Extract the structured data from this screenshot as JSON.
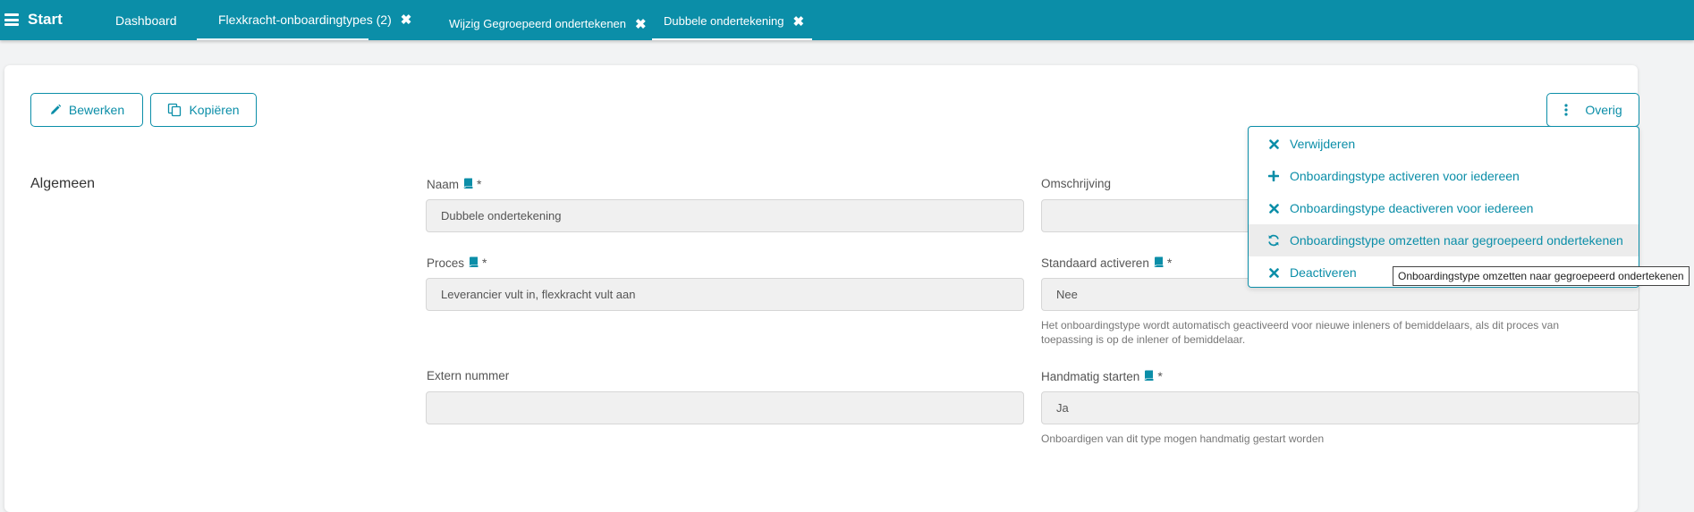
{
  "topbar": {
    "brand": "Start",
    "tabs": [
      {
        "label": "Dashboard",
        "closable": false
      },
      {
        "label": "Flexkracht-onboardingtypes (2)",
        "closable": true
      },
      {
        "label": "Wijzig Gegroepeerd ondertekenen",
        "closable": true
      },
      {
        "label": "Dubbele ondertekening",
        "closable": true
      }
    ],
    "close_glyph": "✖"
  },
  "toolbar": {
    "edit_label": "Bewerken",
    "copy_label": "Kopiëren",
    "more_label": "Overig"
  },
  "dropdown": {
    "items": [
      {
        "label": "Verwijderen",
        "icon": "times-icon"
      },
      {
        "label": "Onboardingstype activeren voor iedereen",
        "icon": "plus-icon"
      },
      {
        "label": "Onboardingstype deactiveren voor iedereen",
        "icon": "times-icon"
      },
      {
        "label": "Onboardingstype omzetten naar gegroepeerd ondertekenen",
        "icon": "refresh-icon"
      },
      {
        "label": "Deactiveren",
        "icon": "times-icon"
      }
    ]
  },
  "tooltip": "Onboardingstype omzetten naar gegroepeerd ondertekenen",
  "section": {
    "title": "Algemeen"
  },
  "fields": {
    "naam": {
      "label": "Naam",
      "value": "Dubbele ondertekening",
      "required": "*"
    },
    "omschrijving": {
      "label": "Omschrijving",
      "value": ""
    },
    "proces": {
      "label": "Proces",
      "value": "Leverancier vult in, flexkracht vult aan",
      "required": "*"
    },
    "standaard_activeren": {
      "label": "Standaard activeren",
      "value": "Nee",
      "required": "*",
      "help": "Het onboardingstype wordt automatisch geactiveerd voor nieuwe inleners of bemiddelaars, als dit proces van toepassing is op de inlener of bemiddelaar."
    },
    "extern_nummer": {
      "label": "Extern nummer",
      "value": ""
    },
    "handmatig_starten": {
      "label": "Handmatig starten",
      "value": "Ja",
      "required": "*",
      "help": "Onboardigen van dit type mogen handmatig gestart worden"
    }
  },
  "colors": {
    "accent": "#0b8ea8",
    "background": "#f2f3f4"
  }
}
